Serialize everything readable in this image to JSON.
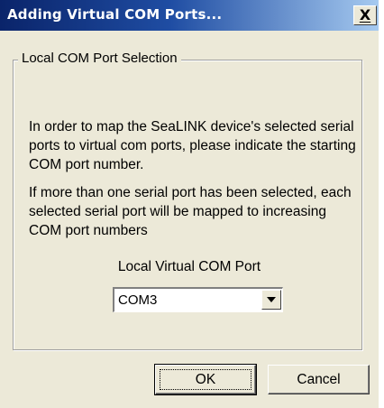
{
  "window": {
    "title": "Adding Virtual COM Ports...",
    "close_glyph": "X"
  },
  "group": {
    "legend": "Local COM Port Selection"
  },
  "content": {
    "paragraph1": "In order to map the SeaLINK device's selected serial ports to virtual com ports, please indicate the starting COM port number.",
    "paragraph2": "If more than one serial port has been selected, each selected serial port will be mapped to increasing COM port numbers"
  },
  "port_select": {
    "label": "Local Virtual COM Port",
    "value": "COM3"
  },
  "buttons": {
    "ok_label": "OK",
    "cancel_label": "Cancel"
  },
  "colors": {
    "titlebar_start": "#0a246a",
    "titlebar_end": "#a6caf0",
    "dialog_background": "#ece9d8"
  }
}
